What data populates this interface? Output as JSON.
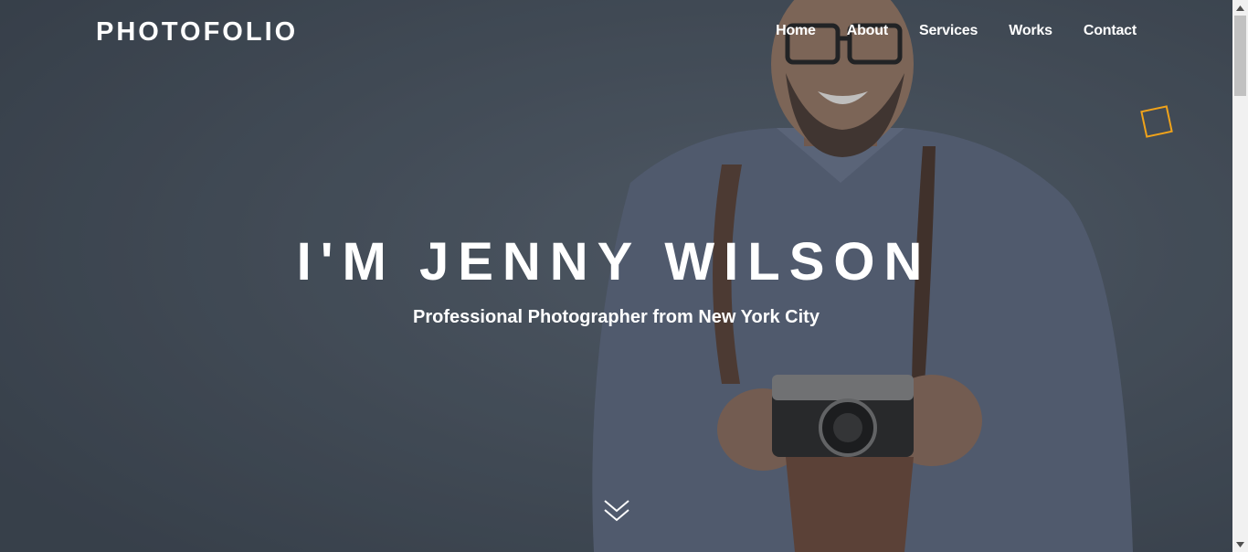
{
  "header": {
    "brand": "PHOTOFOLIO",
    "nav": [
      {
        "label": "Home"
      },
      {
        "label": "About"
      },
      {
        "label": "Services"
      },
      {
        "label": "Works"
      },
      {
        "label": "Contact"
      }
    ]
  },
  "hero": {
    "title": "I'M JENNY WILSON",
    "subtitle": "Professional Photographer from New York City",
    "scroll_icon": "double-chevron-down-icon"
  },
  "colors": {
    "background": "#4b5662",
    "accent": "#f0a31a",
    "text": "#ffffff"
  }
}
